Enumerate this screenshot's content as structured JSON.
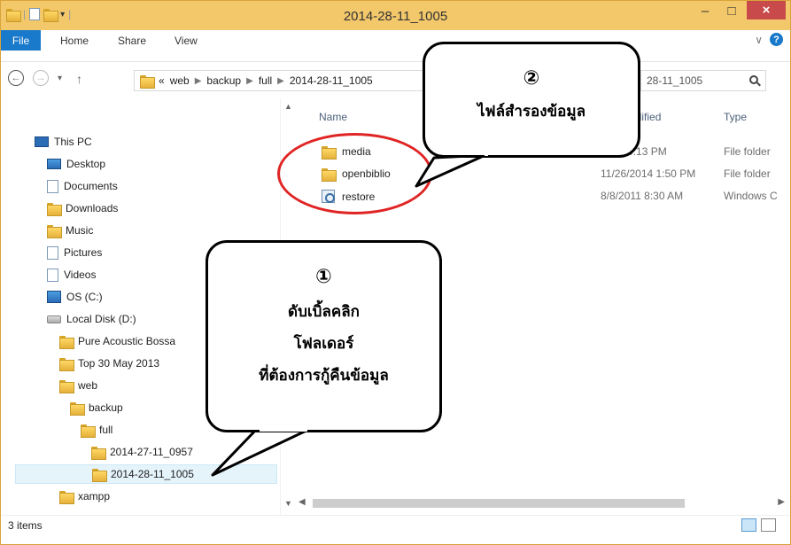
{
  "window": {
    "title": "2014-28-11_1005",
    "minimize_label": "–",
    "maximize_label": "□",
    "close_label": "×"
  },
  "ribbon": {
    "file_tab": "File",
    "tabs": [
      "Home",
      "Share",
      "View"
    ],
    "expand_glyph": "∨",
    "help_glyph": "?"
  },
  "address": {
    "back_glyph": "←",
    "forward_glyph": "→",
    "recent_glyph": "▾",
    "up_glyph": "↑",
    "overflow": "«",
    "crumbs": [
      "web",
      "backup",
      "full",
      "2014-28-11_1005"
    ],
    "search_visible_text": "28-11_1005"
  },
  "navpane": {
    "items": [
      {
        "label": "This PC",
        "icon": "pc-icon",
        "indent": 0
      },
      {
        "label": "Desktop",
        "icon": "desktop-icon",
        "indent": 1
      },
      {
        "label": "Documents",
        "icon": "documents-icon",
        "indent": 1
      },
      {
        "label": "Downloads",
        "icon": "downloads-icon",
        "indent": 1
      },
      {
        "label": "Music",
        "icon": "music-icon",
        "indent": 1
      },
      {
        "label": "Pictures",
        "icon": "pictures-icon",
        "indent": 1
      },
      {
        "label": "Videos",
        "icon": "videos-icon",
        "indent": 1
      },
      {
        "label": "OS (C:)",
        "icon": "os-drive-icon",
        "indent": 1
      },
      {
        "label": "Local Disk (D:)",
        "icon": "drive-icon",
        "indent": 1
      },
      {
        "label": "Pure Acoustic Bossa",
        "icon": "folder-icon",
        "indent": 2
      },
      {
        "label": "Top 30 May 2013",
        "icon": "folder-icon",
        "indent": 2
      },
      {
        "label": "web",
        "icon": "folder-icon",
        "indent": 2
      },
      {
        "label": "backup",
        "icon": "folder-icon",
        "indent": 3
      },
      {
        "label": "full",
        "icon": "folder-icon",
        "indent": 4
      },
      {
        "label": "2014-27-11_0957",
        "icon": "folder-icon",
        "indent": 5
      },
      {
        "label": "2014-28-11_1005",
        "icon": "folder-icon",
        "indent": 5,
        "selected": true
      },
      {
        "label": "xampp",
        "icon": "folder-icon",
        "indent": 2
      }
    ]
  },
  "content": {
    "columns": {
      "name": "Name",
      "date": "odified",
      "type": "Type"
    },
    "files": [
      {
        "name": "media",
        "date": "012 10:13 PM",
        "type": "File folder",
        "icon": "folder-icon"
      },
      {
        "name": "openbiblio",
        "date": "11/26/2014 1:50 PM",
        "type": "File folder",
        "icon": "folder-icon"
      },
      {
        "name": "restore",
        "date": "8/8/2011 8:30 AM",
        "type": "Windows C",
        "icon": "restore-icon"
      }
    ]
  },
  "status": {
    "item_count": "3 items"
  },
  "callouts": {
    "one": {
      "number": "①",
      "lines": [
        "ดับเบิ้ลคลิก",
        "โฟลเดอร์",
        "ที่ต้องการกู้คืนข้อมูล"
      ]
    },
    "two": {
      "number": "②",
      "lines": [
        "ไฟล์สำรองข้อมูล"
      ]
    }
  },
  "colors": {
    "titlebar": "#f3c86b",
    "file_tab": "#1979ca",
    "close_button": "#c94a4a",
    "highlight_ring": "#e02424",
    "selection": "#e5f3fb"
  }
}
